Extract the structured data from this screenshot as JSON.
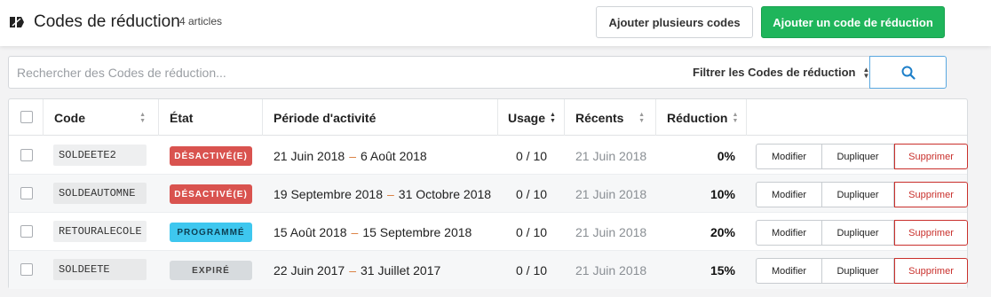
{
  "header": {
    "title": "Codes de réduction",
    "count": "4 articles",
    "bulk_button": "Ajouter plusieurs codes",
    "add_button": "Ajouter un code de réduction"
  },
  "search": {
    "placeholder": "Rechercher des Codes de réduction...",
    "filter_label": "Filtrer les Codes de réduction"
  },
  "table": {
    "columns": [
      "Code",
      "État",
      "Période d'activité",
      "Usage",
      "Récents",
      "Réduction"
    ],
    "actions": {
      "edit": "Modifier",
      "duplicate": "Dupliquer",
      "delete": "Supprimer"
    },
    "rows": [
      {
        "code": "SOLDEETE2",
        "state": "DÉSACTIVÉ(E)",
        "start": "21 Juin 2018",
        "end": "6 Août 2018",
        "usage": "0 / 10",
        "recent": "21 Juin 2018",
        "reduction": "0%"
      },
      {
        "code": "SOLDEAUTOMNE",
        "state": "DÉSACTIVÉ(E)",
        "start": "19 Septembre 2018",
        "end": "31 Octobre 2018",
        "usage": "0 / 10",
        "recent": "21 Juin 2018",
        "reduction": "10%"
      },
      {
        "code": "RETOURALECOLE",
        "state": "PROGRAMMÉ",
        "start": "15 Août 2018",
        "end": "15 Septembre 2018",
        "usage": "0 / 10",
        "recent": "21 Juin 2018",
        "reduction": "20%"
      },
      {
        "code": "SOLDEETE",
        "state": "EXPIRÉ",
        "start": "22 Juin 2017",
        "end": "31 Juillet 2017",
        "usage": "0 / 10",
        "recent": "21 Juin 2018",
        "reduction": "15%"
      }
    ]
  },
  "colors": {
    "primary": "#1fb55b",
    "disabled_badge": "#d9534f",
    "scheduled_badge": "#3ec7ef",
    "expired_badge": "#d7dbde",
    "delete": "#c9302c"
  }
}
